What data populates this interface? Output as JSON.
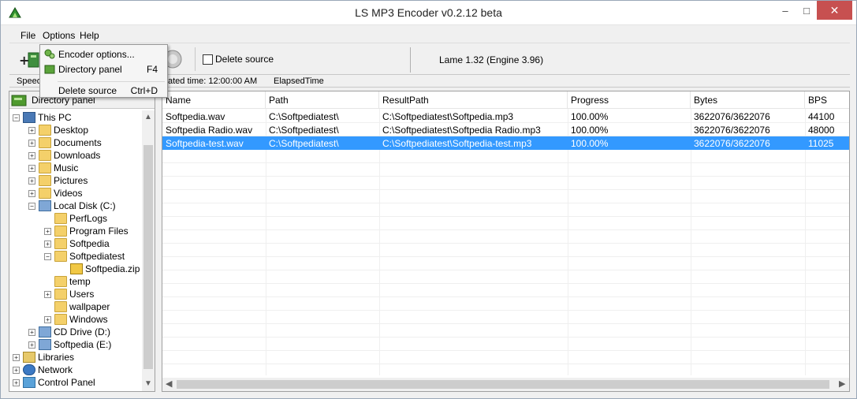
{
  "window": {
    "title": "LS MP3 Encoder v0.2.12 beta",
    "minimize": "–",
    "maximize": "□",
    "close": "✕"
  },
  "menu": {
    "file": "File",
    "options": "Options",
    "help": "Help"
  },
  "options_menu": {
    "items": [
      {
        "label": "Encoder options...",
        "shortcut": "",
        "icon": "gears-icon"
      },
      {
        "label": "Directory panel",
        "shortcut": "F4",
        "icon": "directory-panel-icon"
      },
      {
        "label": "Delete source",
        "shortcut": "Ctrl+D",
        "icon": ""
      }
    ]
  },
  "toolbar": {
    "delete_source_label": "Delete source",
    "delete_source_checked": false,
    "lame_version": "Lame 1.32 (Engine 3.96)"
  },
  "status": {
    "speed": "Speed",
    "estimated_time": "ated time: 12:00:00 AM",
    "elapsed": "ElapsedTime"
  },
  "directory_panel": {
    "title": "Directory panel",
    "tree": [
      {
        "label": "This PC",
        "expander": "−",
        "icon": "pc-icon"
      },
      {
        "label": "Desktop",
        "expander": "+",
        "icon": "desktop-folder-icon"
      },
      {
        "label": "Documents",
        "expander": "+",
        "icon": "documents-folder-icon"
      },
      {
        "label": "Downloads",
        "expander": "+",
        "icon": "downloads-folder-icon"
      },
      {
        "label": "Music",
        "expander": "+",
        "icon": "music-folder-icon"
      },
      {
        "label": "Pictures",
        "expander": "+",
        "icon": "pictures-folder-icon"
      },
      {
        "label": "Videos",
        "expander": "+",
        "icon": "videos-folder-icon"
      },
      {
        "label": "Local Disk (C:)",
        "expander": "−",
        "icon": "local-disk-icon"
      },
      {
        "label": "PerfLogs",
        "expander": "",
        "icon": "folder-icon"
      },
      {
        "label": "Program Files",
        "expander": "+",
        "icon": "folder-icon"
      },
      {
        "label": "Softpedia",
        "expander": "+",
        "icon": "folder-icon"
      },
      {
        "label": "Softpediatest",
        "expander": "−",
        "icon": "folder-icon"
      },
      {
        "label": "Softpedia.zip",
        "expander": "",
        "icon": "zip-folder-icon"
      },
      {
        "label": "temp",
        "expander": "",
        "icon": "folder-icon"
      },
      {
        "label": "Users",
        "expander": "+",
        "icon": "folder-icon"
      },
      {
        "label": "wallpaper",
        "expander": "",
        "icon": "folder-icon"
      },
      {
        "label": "Windows",
        "expander": "+",
        "icon": "folder-icon"
      },
      {
        "label": "CD Drive (D:)",
        "expander": "+",
        "icon": "cd-drive-icon"
      },
      {
        "label": "Softpedia (E:)",
        "expander": "+",
        "icon": "network-drive-icon"
      },
      {
        "label": "Libraries",
        "expander": "+",
        "icon": "libraries-icon"
      },
      {
        "label": "Network",
        "expander": "+",
        "icon": "network-icon"
      },
      {
        "label": "Control Panel",
        "expander": "+",
        "icon": "control-panel-icon"
      }
    ]
  },
  "list": {
    "columns": [
      "Name",
      "Path",
      "ResultPath",
      "Progress",
      "Bytes",
      "BPS"
    ],
    "rows": [
      {
        "name": "Softpedia.wav",
        "path": "C:\\Softpediatest\\",
        "result": "C:\\Softpediatest\\Softpedia.mp3",
        "progress": "100.00%",
        "bytes": "3622076/3622076",
        "bps": "44100",
        "selected": false
      },
      {
        "name": "Softpedia Radio.wav",
        "path": "C:\\Softpediatest\\",
        "result": "C:\\Softpediatest\\Softpedia Radio.mp3",
        "progress": "100.00%",
        "bytes": "3622076/3622076",
        "bps": "48000",
        "selected": false
      },
      {
        "name": "Softpedia-test.wav",
        "path": "C:\\Softpediatest\\",
        "result": "C:\\Softpediatest\\Softpedia-test.mp3",
        "progress": "100.00%",
        "bytes": "3622076/3622076",
        "bps": "11025",
        "selected": true
      }
    ]
  },
  "colors": {
    "selection": "#3399ff",
    "close_button": "#c75050"
  }
}
